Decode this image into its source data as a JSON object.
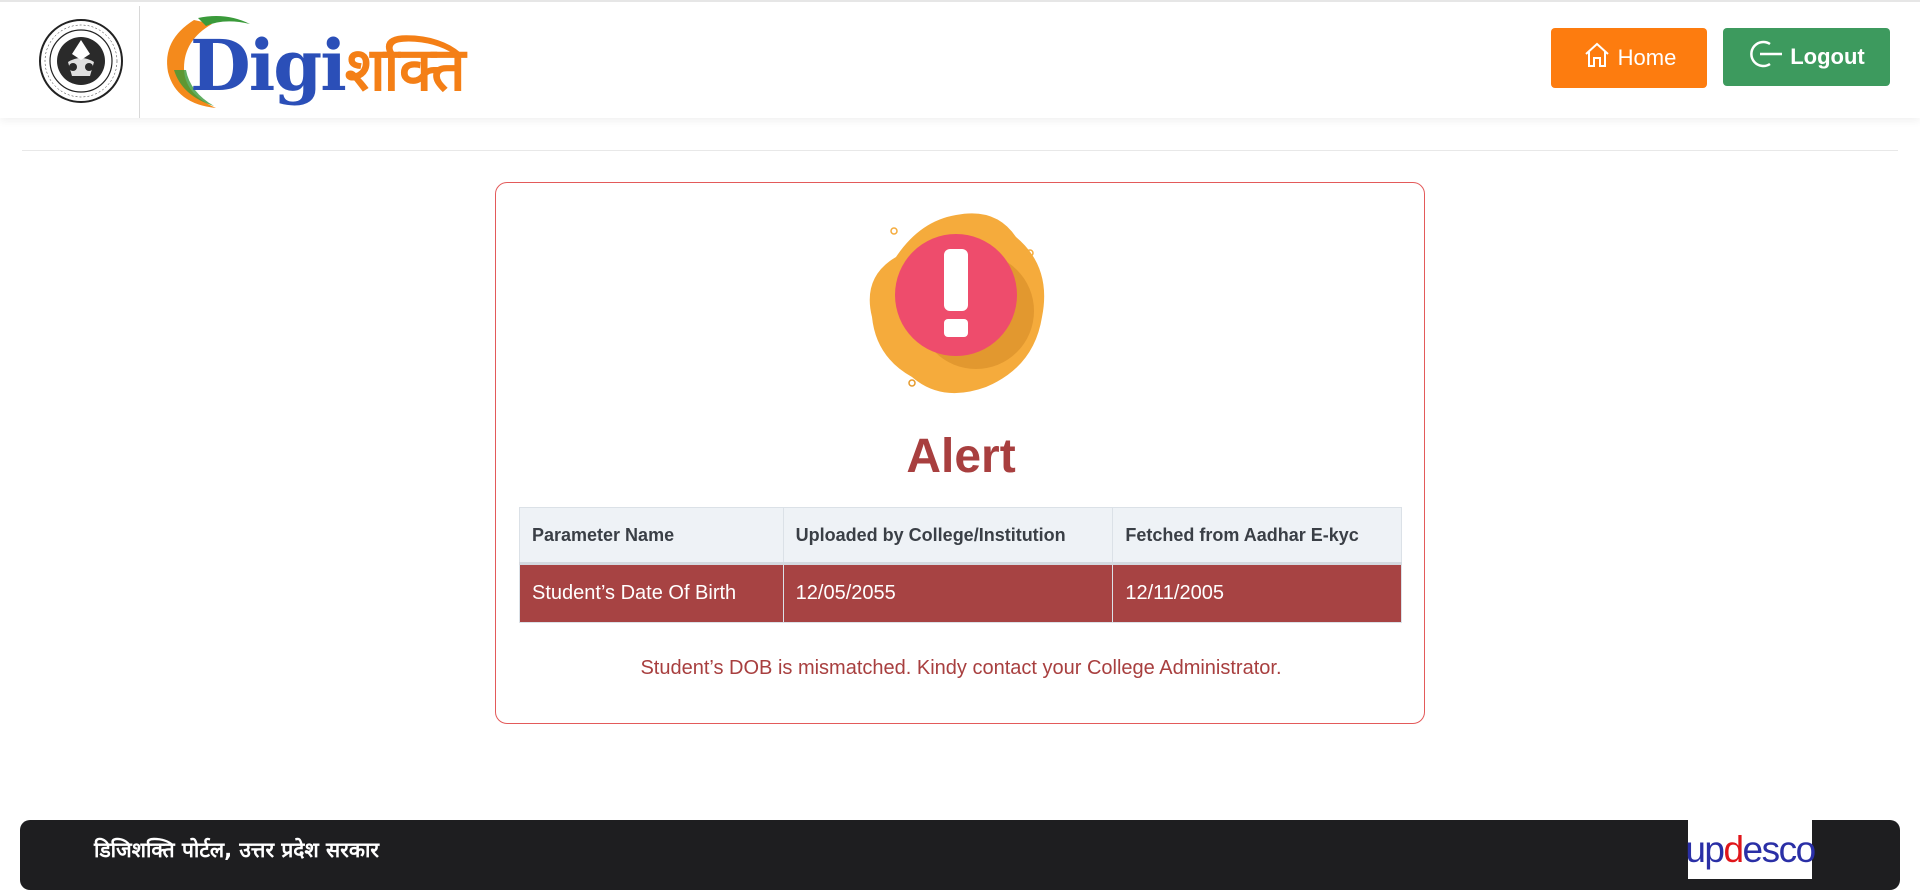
{
  "header": {
    "logo": {
      "text_latin": "Digi",
      "text_devanagari": "शक्ति"
    },
    "home_label": "Home",
    "logout_label": "Logout"
  },
  "card": {
    "title": "Alert",
    "table": {
      "headers": [
        "Parameter Name",
        "Uploaded by College/Institution",
        "Fetched from Aadhar E-kyc"
      ],
      "rows": [
        [
          "Student’s Date Of Birth",
          "12/05/2055",
          "12/11/2005"
        ]
      ]
    },
    "message": "Student’s DOB is mismatched. Kindy contact your College Administrator."
  },
  "footer": {
    "text": "डिजिशक्ति पोर्टल, उत्तर प्रदेश सरकार",
    "partner_logo": "updesco"
  },
  "colors": {
    "home_button": "#fd7c0f",
    "logout_button": "#3d9a5e",
    "alert_red": "#a83f3f",
    "row_bg": "#a74343",
    "footer_bg": "#1e1e20"
  }
}
